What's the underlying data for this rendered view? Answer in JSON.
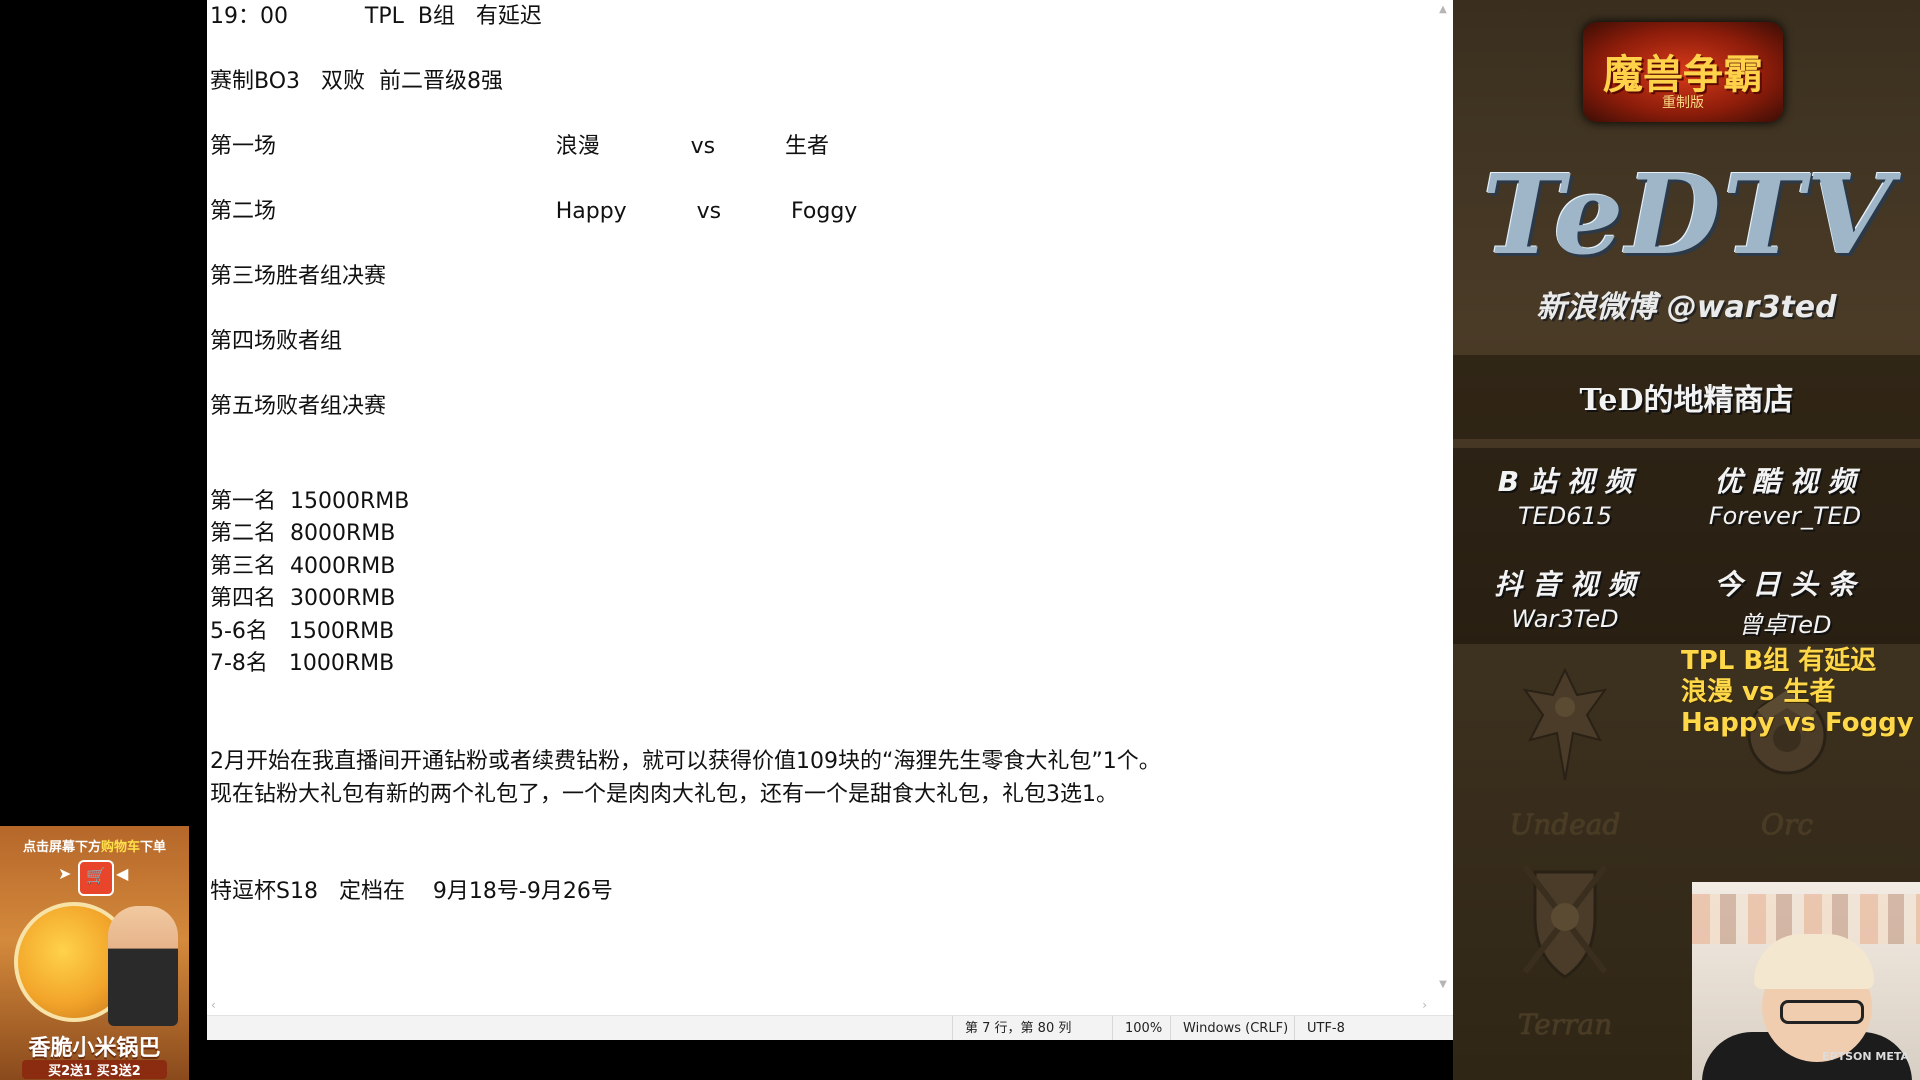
{
  "promo": {
    "top_text_a": "点击屏幕下方",
    "top_text_hl": "购物车",
    "top_text_b": "下单",
    "title": "香脆小米锅巴",
    "subtitle": "买2送1 买3送2",
    "icons": [
      "cart-icon",
      "arrow-right-icon",
      "arrow-left-icon"
    ]
  },
  "notepad": {
    "lines": [
      "19：00           TPL  B组   有延迟",
      "赛制BO3   双败  前二晋级8强",
      "第一场                                        浪漫             vs          生者",
      "第二场                                        Happy          vs          Foggy",
      "第三场胜者组决赛",
      "第四场败者组",
      "第五场败者组决赛",
      "第一名  15000RMB",
      "第二名  8000RMB",
      "第三名  4000RMB",
      "第四名  3000RMB",
      "5-6名   1500RMB",
      "7-8名   1000RMB",
      "2月开始在我直播间开通钻粉或者续费钻粉，就可以获得价值109块的“海狸先生零食大礼包”1个。",
      "现在钻粉大礼包有新的两个礼包了，一个是肉肉大礼包，还有一个是甜食大礼包，礼包3选1。",
      "特逗杯S18   定档在    9月18号-9月26号"
    ],
    "status": {
      "position": "第 7 行，第 80 列",
      "zoom": "100%",
      "line_ending": "Windows (CRLF)",
      "encoding": "UTF-8"
    }
  },
  "panel": {
    "game_logo_title": "魔兽争霸",
    "game_logo_sub": "重制版",
    "brand": "TeDTV",
    "weibo": "新浪微博 @war3ted",
    "shop": "TeD的地精商店",
    "links": [
      {
        "platform": "B 站 视 频",
        "handle": "TED615"
      },
      {
        "platform": "优 酷 视 频",
        "handle": "Forever_TED"
      },
      {
        "platform": "抖 音 视 频",
        "handle": "War3TeD"
      },
      {
        "platform": "今 日 头 条",
        "handle": "曾卓TeD"
      }
    ],
    "overlay": [
      "TPL B组 有延迟",
      "浪漫 vs 生者",
      "Happy vs Foggy"
    ],
    "races": [
      "Undead",
      "Orc",
      "Terran"
    ],
    "cam_shirt": "EPTSON META"
  },
  "colors": {
    "overlay_text": "#ffd84a",
    "panel_bg": "#3a2f1f",
    "notepad_bg": "#ffffff"
  }
}
